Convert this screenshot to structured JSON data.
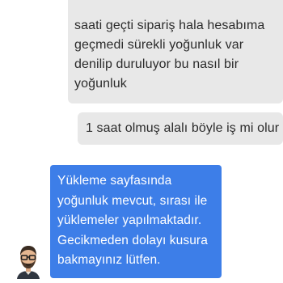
{
  "conversation": {
    "messages": [
      {
        "sender": "user",
        "lines": [
          "saati geçti sipariş hala hesabıma",
          "geçmedi sürekli yoğunluk var",
          "denilip duruluyor bu nasıl bir",
          "yoğunluk"
        ]
      },
      {
        "sender": "user",
        "lines": [
          "1 saat olmuş alalı böyle iş mi olur"
        ]
      },
      {
        "sender": "agent",
        "lines": [
          "Yükleme sayfasında",
          "yoğunluk mevcut, sırası ile",
          "yüklemeler yapılmaktadır.",
          "Gecikmeden dolayı kusura",
          "bakmayınız lütfen."
        ]
      }
    ]
  },
  "colors": {
    "user_bubble": "#e8e8e8",
    "agent_bubble": "#3d7ee8",
    "accent": "#4a86e8"
  },
  "icons": {
    "agent_avatar": "support-agent-avatar-icon"
  }
}
